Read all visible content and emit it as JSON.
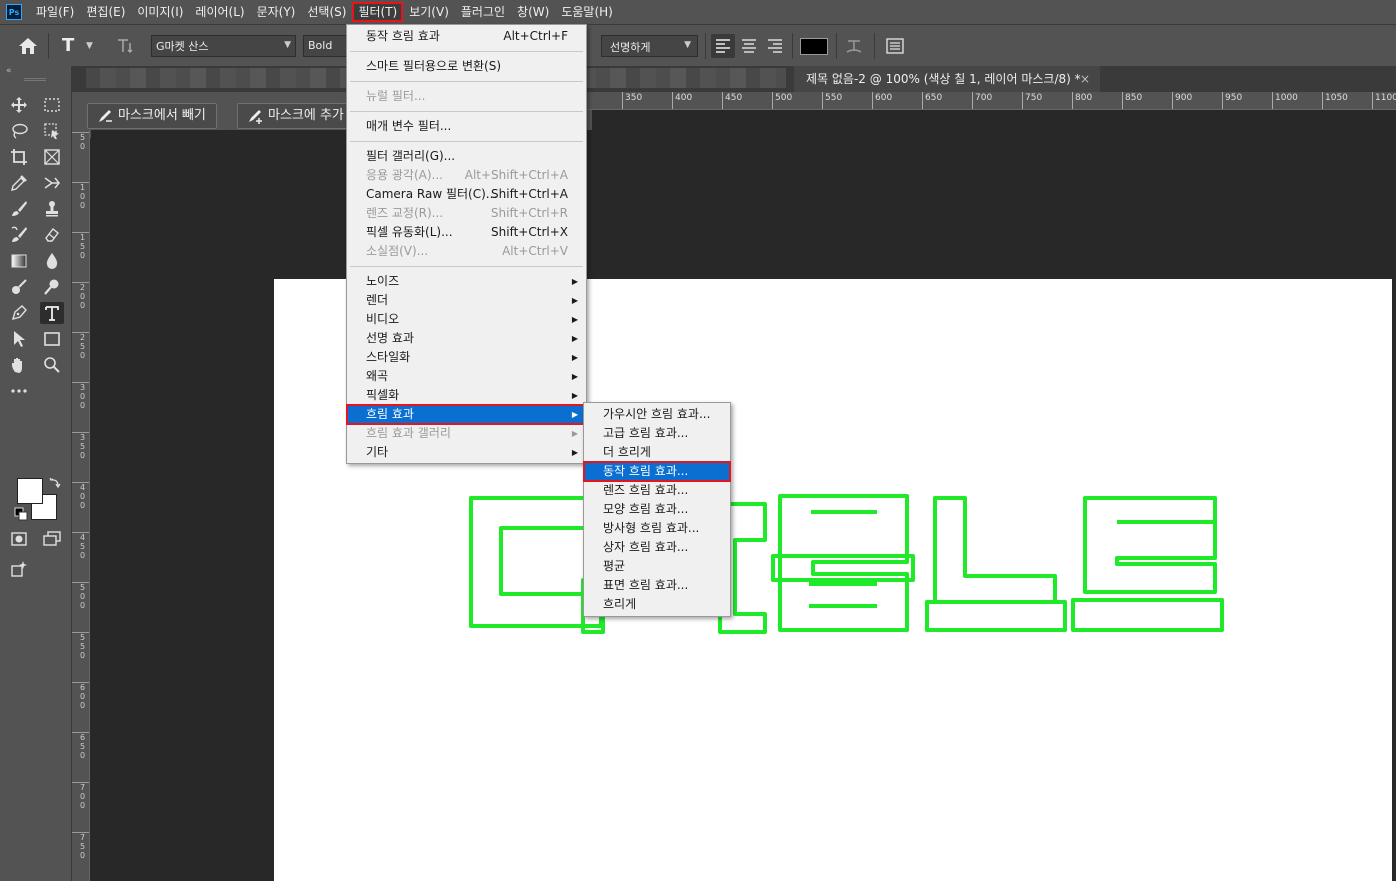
{
  "app": {
    "logo_text": "Ps"
  },
  "menubar": {
    "items": [
      "파일(F)",
      "편집(E)",
      "이미지(I)",
      "레이어(L)",
      "문자(Y)",
      "선택(S)",
      "필터(T)",
      "보기(V)",
      "플러그인",
      "창(W)",
      "도움말(H)"
    ]
  },
  "options": {
    "tool_glyph": "T",
    "font_family": "G마켓 산스",
    "font_style": "Bold",
    "anti_alias": "선명하게"
  },
  "mask_buttons": {
    "subtract": "마스크에서 빼기",
    "add": "마스크에 추가"
  },
  "document_tab": {
    "title": "제목 없음-2 @ 100% (색상 칠 1, 레이어 마스크/8) *",
    "close": "×"
  },
  "ruler_top": [
    "350",
    "400",
    "450",
    "500",
    "550",
    "600",
    "650",
    "700",
    "750",
    "800",
    "850",
    "900",
    "950",
    "1000",
    "1050",
    "1100"
  ],
  "ruler_left": [
    "5\n0",
    "1\n0\n0",
    "1\n5\n0",
    "2\n0\n0",
    "2\n5\n0",
    "3\n0\n0",
    "3\n5\n0",
    "4\n0\n0",
    "4\n5\n0",
    "5\n0\n0",
    "5\n5\n0",
    "6\n0\n0",
    "6\n5\n0",
    "7\n0\n0",
    "7\n5\n0"
  ],
  "filter_menu": {
    "group1": [
      {
        "label": "동작 흐림 효과",
        "shortcut": "Alt+Ctrl+F"
      }
    ],
    "group2": [
      {
        "label": "스마트 필터용으로 변환(S)"
      }
    ],
    "group3": [
      {
        "label": "뉴럴 필터...",
        "disabled": true
      }
    ],
    "group4": [
      {
        "label": "매개 변수 필터..."
      }
    ],
    "group5": [
      {
        "label": "필터 갤러리(G)..."
      },
      {
        "label": "응용 광각(A)...",
        "shortcut": "Alt+Shift+Ctrl+A",
        "disabled": true
      },
      {
        "label": "Camera Raw 필터(C)...",
        "shortcut": "Shift+Ctrl+A"
      },
      {
        "label": "렌즈 교정(R)...",
        "shortcut": "Shift+Ctrl+R",
        "disabled": true
      },
      {
        "label": "픽셀 유동화(L)...",
        "shortcut": "Shift+Ctrl+X"
      },
      {
        "label": "소실점(V)...",
        "shortcut": "Alt+Ctrl+V",
        "disabled": true
      }
    ],
    "group6": [
      {
        "label": "노이즈"
      },
      {
        "label": "렌더"
      },
      {
        "label": "비디오"
      },
      {
        "label": "선명 효과"
      },
      {
        "label": "스타일화"
      },
      {
        "label": "왜곡"
      },
      {
        "label": "픽셀화"
      },
      {
        "label": "흐림 효과"
      },
      {
        "label": "흐림 효과 갤러리",
        "disabled": true
      },
      {
        "label": "기타"
      }
    ]
  },
  "blur_submenu": [
    "가우시안 흐림 효과...",
    "고급 흐림 효과...",
    "더 흐리게",
    "동작 흐림 효과...",
    "렌즈 흐림 효과...",
    "모양 흐림 효과...",
    "방사형 흐림 효과...",
    "상자 흐림 효과...",
    "평균",
    "표면 흐림 효과...",
    "흐리게"
  ],
  "colors": {
    "accent_highlight": "#e8141c",
    "menu_selection": "#0b6fd1",
    "outline_text": "#1eea2a"
  }
}
